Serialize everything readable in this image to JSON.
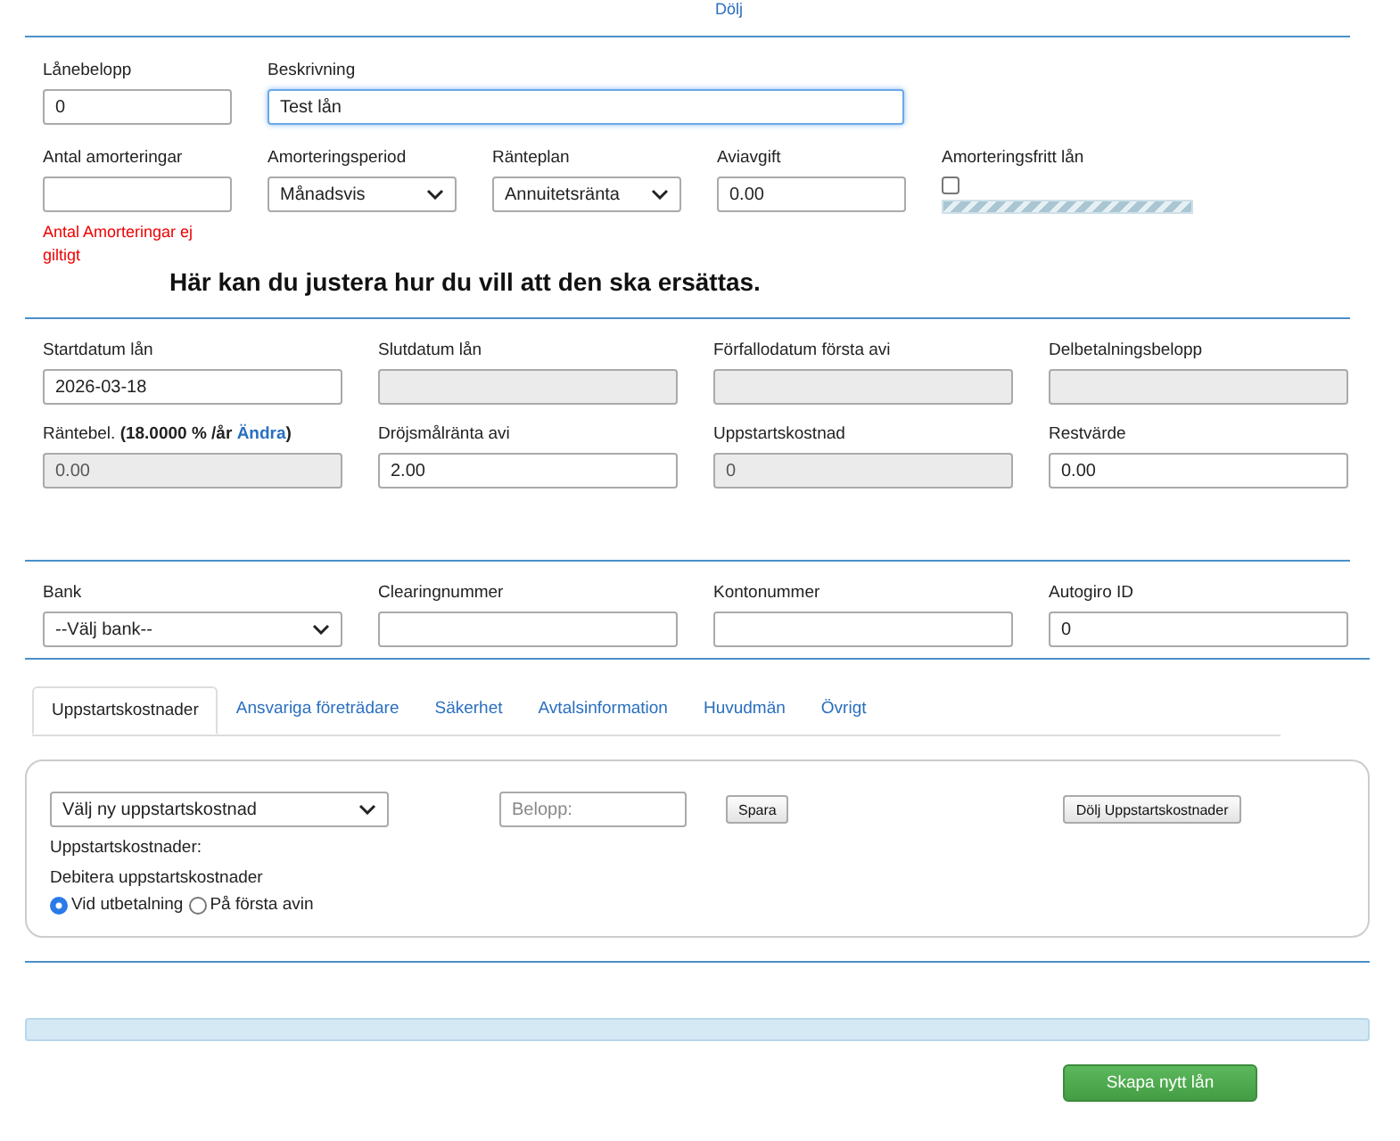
{
  "top_link": "Dölj",
  "loan_rows": [
    [
      {
        "kind": "text",
        "label": "Lånebelopp",
        "value": "0"
      },
      {
        "kind": "text",
        "label": "Beskrivning",
        "value": "Test lån",
        "focused": true
      }
    ],
    [
      {
        "kind": "text",
        "label": "Antal amorteringar",
        "error": "Antal Amorteringar ej giltigt"
      },
      {
        "kind": "select",
        "label": "Amorteringsperiod",
        "value": "Månadsvis"
      },
      {
        "kind": "select",
        "label": "Ränteplan",
        "value": "Annuitetsränta"
      },
      {
        "kind": "text",
        "label": "Aviavgift",
        "value": "0.00"
      },
      {
        "kind": "checkbox",
        "label": "Amorteringsfritt lån",
        "checked": false
      }
    ]
  ],
  "heading": "Här kan du justera hur du vill att den ska ersättas.",
  "terms": [
    {
      "kind": "text",
      "label": "Startdatum lån",
      "value": "2026-03-18",
      "disabled": false
    },
    {
      "kind": "text",
      "label": "Slutdatum lån",
      "disabled": true
    },
    {
      "kind": "text",
      "label": "Förfallodatum första avi",
      "disabled": true
    },
    {
      "kind": "text",
      "label": "Delbetalningsbelopp",
      "disabled": true
    },
    {
      "kind": "rate",
      "label": "Räntebel.",
      "rate": "(18.0000 % /år",
      "link": "Ändra",
      "suffix": ")",
      "value": "0.00",
      "disabled": true
    },
    {
      "kind": "text",
      "label": "Dröjsmålränta avi",
      "value": "2.00",
      "disabled": false
    },
    {
      "kind": "text",
      "label": "Uppstartskostnad",
      "value": "0",
      "disabled": true
    },
    {
      "kind": "text",
      "label": "Restvärde",
      "value": "0.00",
      "disabled": false
    }
  ],
  "bank": [
    {
      "kind": "select",
      "label": "Bank",
      "value": "--Välj bank--"
    },
    {
      "kind": "text",
      "label": "Clearingnummer"
    },
    {
      "kind": "text",
      "label": "Kontonummer"
    },
    {
      "kind": "text",
      "label": "Autogiro ID",
      "value": "0"
    }
  ],
  "tabs": [
    {
      "label": "Uppstartskostnader",
      "selected": true
    },
    {
      "label": "Ansvariga företrädare",
      "selected": false
    },
    {
      "label": "Säkerhet",
      "selected": false
    },
    {
      "label": "Avtalsinformation",
      "selected": false
    },
    {
      "label": "Huvudmän",
      "selected": false
    },
    {
      "label": "Övrigt",
      "selected": false
    }
  ],
  "panel": {
    "select": "Välj ny uppstartskostnad",
    "amount": {
      "placeholder": "Belopp:"
    },
    "save": "Spara",
    "hide": "Dölj Uppstartskostnader",
    "costs_label": "Uppstartskostnader:",
    "charge_label": "Debitera uppstartskostnader",
    "options": [
      {
        "label": "Vid utbetalning",
        "selected": true
      },
      {
        "label": "På första avin",
        "selected": false
      }
    ]
  },
  "create_button": "Skapa nytt lån"
}
